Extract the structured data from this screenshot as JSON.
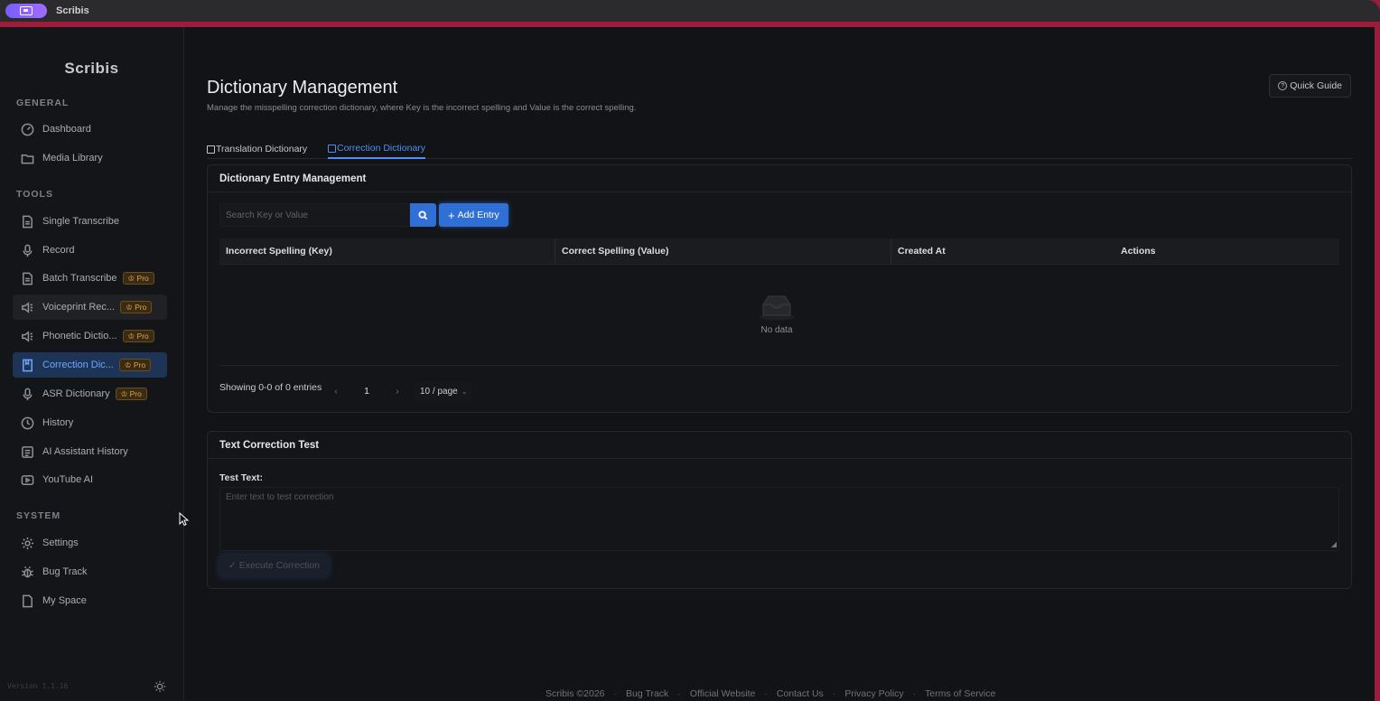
{
  "window": {
    "app_title": "Scribis"
  },
  "sidebar": {
    "brand": "Scribis",
    "sections": {
      "general": "GENERAL",
      "tools": "TOOLS",
      "system": "SYSTEM"
    },
    "items": [
      {
        "label": "Dashboard",
        "icon": "dashboard-icon"
      },
      {
        "label": "Media Library",
        "icon": "folder-icon"
      },
      {
        "label": "Single Transcribe",
        "icon": "document-icon"
      },
      {
        "label": "Record",
        "icon": "microphone-icon"
      },
      {
        "label": "Batch Transcribe",
        "icon": "document-icon",
        "badge": "Pro"
      },
      {
        "label": "Voiceprint Rec...",
        "icon": "speaker-icon",
        "badge": "Pro"
      },
      {
        "label": "Phonetic Dictio...",
        "icon": "speaker-icon",
        "badge": "Pro"
      },
      {
        "label": "Correction Dic...",
        "icon": "book-icon",
        "badge": "Pro"
      },
      {
        "label": "ASR Dictionary",
        "icon": "microphone-icon",
        "badge": "Pro"
      },
      {
        "label": "History",
        "icon": "clock-icon"
      },
      {
        "label": "AI Assistant History",
        "icon": "assistant-icon"
      },
      {
        "label": "YouTube AI",
        "icon": "play-icon"
      },
      {
        "label": "Settings",
        "icon": "gear-icon"
      },
      {
        "label": "Bug Track",
        "icon": "bug-icon"
      },
      {
        "label": "My Space",
        "icon": "document-icon"
      }
    ],
    "version": "Version 1.1.16"
  },
  "header": {
    "title": "Dictionary Management",
    "subtitle": "Manage the misspelling correction dictionary, where Key is the incorrect spelling and Value is the correct spelling.",
    "guide_label": "Quick Guide"
  },
  "tabs": [
    {
      "label": "Translation Dictionary"
    },
    {
      "label": "Correction Dictionary",
      "active": true
    }
  ],
  "entry_card": {
    "title": "Dictionary Entry Management",
    "search_placeholder": "Search Key or Value",
    "add_label": "Add Entry",
    "columns": [
      "Incorrect Spelling (Key)",
      "Correct Spelling (Value)",
      "Created At",
      "Actions"
    ],
    "empty_text": "No data",
    "showing": "Showing 0-0 of 0 entries",
    "current_page": "1",
    "page_size": "10 / page"
  },
  "test_card": {
    "title": "Text Correction Test",
    "field_label": "Test Text:",
    "placeholder": "Enter text to test correction",
    "execute_label": "Execute Correction"
  },
  "footer": {
    "links": [
      "Scribis ©2026",
      "Bug Track",
      "Official Website",
      "Contact Us",
      "Privacy Policy",
      "Terms of Service"
    ]
  },
  "colors": {
    "accent": "#2f6fd6",
    "active_text": "#6ea6ff",
    "pro_badge": "#e4a23c",
    "background": "#121316"
  }
}
